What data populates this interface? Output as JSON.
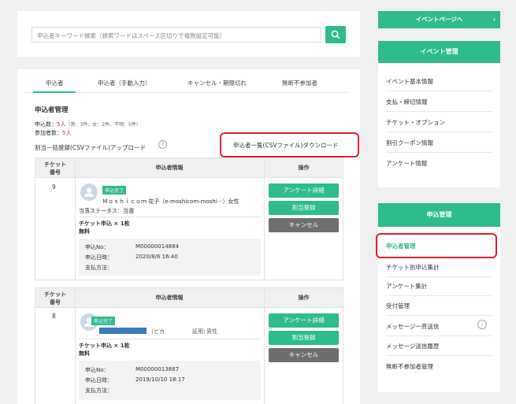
{
  "search": {
    "placeholder": "申込者キーワード検索（検索ワードはスペース区切りで複数設定可能）"
  },
  "tabs": [
    {
      "label": "申込者"
    },
    {
      "label": "申込者（手動入力）"
    },
    {
      "label": "キャンセル・期限切れ"
    },
    {
      "label": "無断不参加者"
    }
  ],
  "section": {
    "title": "申込者管理",
    "count_label": "申込数：",
    "count_value": "5人",
    "count_detail": "（男：3件、女：2件、不明：0件）",
    "participant_label": "参加者数：",
    "participant_value": "5人",
    "bulk_upload_link": "割当一括登録(CSVファイル)アップロード",
    "download_link": "申込者一覧(CSVファイル)ダウンロード"
  },
  "table": {
    "col_ticket": "チケット番号",
    "col_info": "申込者情報",
    "col_action": "操作"
  },
  "applicants": [
    {
      "ticket_no": "9",
      "status_badge": "申込完了",
      "name": "Ｍｏｓｈｉｃｏｍ 花子（e-moshicom-moshi···）女性",
      "attend_status": "当落ステータス：当選",
      "ticket_line": "チケット申込 × 1枚",
      "price": "無料",
      "apply_no_label": "申込No：",
      "apply_no": "M00000014884",
      "apply_date_label": "申込日時：",
      "apply_date": "2020/8/6 16:40",
      "payment_label": "支払方法：",
      "btn_survey": "アンケート詳細",
      "btn_assign": "割当登録",
      "btn_cancel": "キャンセル"
    },
    {
      "ticket_no": "8",
      "status_badge": "申込完了",
      "name_kana": "（ヒカ　　　　　証用）",
      "gender": "男性",
      "ticket_line": "チケット申込 × 1枚",
      "price": "無料",
      "apply_no_label": "申込No：",
      "apply_no": "M00000013887",
      "apply_date_label": "申込日時：",
      "apply_date": "2019/10/10 18:17",
      "payment_label": "支払方法：",
      "btn_survey": "アンケート詳細",
      "btn_assign": "割当登録",
      "btn_cancel": "キャンセル"
    }
  ],
  "sidebar": {
    "event_page_btn": "イベントページへ",
    "event_mgmt_title": "イベント管理",
    "event_items": [
      "イベント基本情報",
      "支払・締切情報",
      "チケット・オプション",
      "割引クーポン情報",
      "アンケート情報"
    ],
    "app_mgmt_title": "申込管理",
    "app_items": [
      "申込者管理",
      "チケット別申込集計",
      "アンケート集計",
      "受付管理",
      "メッセージ一斉送信",
      "メッセージ送信履歴",
      "無断不参加者管理"
    ]
  },
  "colors": {
    "accent": "#2ebc8a",
    "highlight": "#e0202f",
    "cancel": "#6e6e6e"
  }
}
